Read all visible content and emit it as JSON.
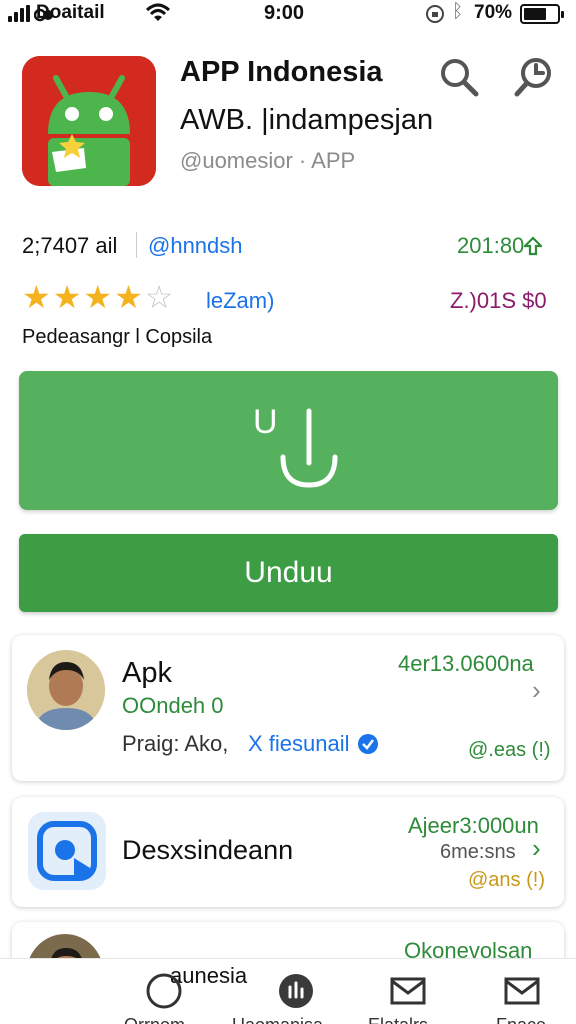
{
  "status_bar": {
    "carrier": "Doaitail",
    "time": "9:00",
    "battery_percent_label": "70%",
    "battery_level": 0.7
  },
  "app": {
    "title": "APP Indonesia",
    "subtitle": "AWB. |indampesjan",
    "developer": "@uomesior · APP",
    "icon": "android-robot-icon"
  },
  "header_actions": {
    "search_icon": "search-icon",
    "history_icon": "history-icon"
  },
  "stats": {
    "downloads": "2;7407 ail",
    "handle": "@hnndsh",
    "size": "201:80",
    "rating_value": 4.5,
    "rating_label": "leZam)",
    "price": "Z.)01S $0",
    "category": "Pedeasangr l Copsila"
  },
  "actions": {
    "open_label": "U",
    "download_label": "Unduu"
  },
  "cards": [
    {
      "title": "Apk",
      "subtitle": "OOndeh 0",
      "detail": "Praig: Ako, ",
      "link": "X fiesunail",
      "meta_top": "4er13.0600na",
      "meta_bottom": "@.eas (!)"
    },
    {
      "title": "Desxsindeann",
      "meta_top": "Ajeer3:000un",
      "meta_mid": "6me:sns",
      "meta_bottom": "@ans (!)"
    },
    {
      "title": "aunesia",
      "meta_top": "Okonevolsan"
    }
  ],
  "bottom_nav": {
    "items": [
      {
        "label": "Orrnom",
        "icon": "circle-icon"
      },
      {
        "label": "Uaomanisa",
        "icon": "apps-icon"
      },
      {
        "label": "Elatalrs",
        "icon": "mail-icon"
      },
      {
        "label": "Fnace",
        "icon": "mail-icon"
      }
    ]
  },
  "colors": {
    "accent_green": "#3d9d45",
    "open_button_green": "#56b15e",
    "link_blue": "#1a73e8",
    "star_gold": "#f5b21f",
    "app_icon_red": "#d32a1f",
    "price_purple": "#8b1a6b"
  }
}
